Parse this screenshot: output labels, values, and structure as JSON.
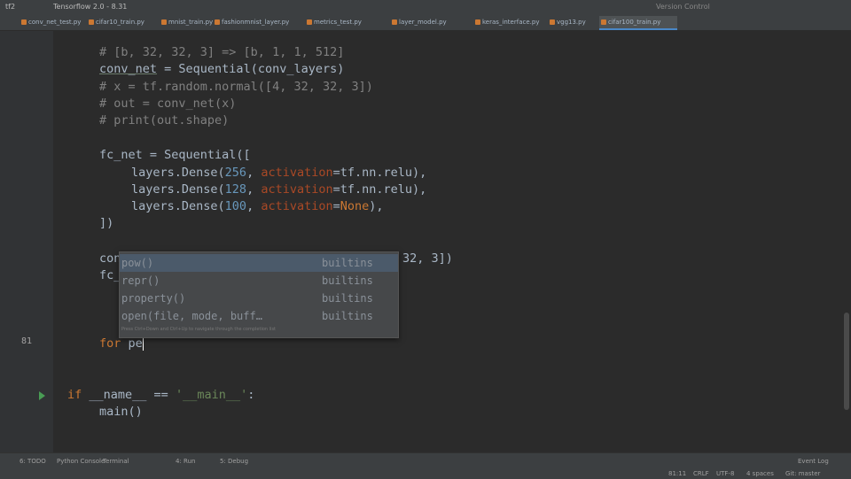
{
  "window": {
    "title": "Tensorflow 2.0 - 8.31",
    "project_label": "tf2",
    "menu_hint": "Version Control"
  },
  "tabs": [
    {
      "label": "conv_net_test.py",
      "color": "#cc7832"
    },
    {
      "label": "cifar10_train.py",
      "color": "#cc7832"
    },
    {
      "label": "mnist_train.py",
      "color": "#cc7832"
    },
    {
      "label": "fashionmnist_layer.py",
      "color": "#cc7832"
    },
    {
      "label": "metrics_test.py",
      "color": "#cc7832"
    },
    {
      "label": "layer_model.py",
      "color": "#cc7832"
    },
    {
      "label": "keras_interface.py",
      "color": "#cc7832"
    },
    {
      "label": "vgg13.py",
      "color": "#cc7832"
    },
    {
      "label": "cifar100_train.py",
      "color": "#cc7832",
      "active": true
    }
  ],
  "code": {
    "lines": [
      {
        "num": "",
        "comment": "# [b, 32, 32, 3] => [b, 1, 1, 512]"
      },
      {
        "num": "",
        "var": "conv_net",
        "eq": " = Sequential(conv_layers)"
      },
      {
        "num": "",
        "comment": "# x = tf.random.normal([4, 32, 32, 3])"
      },
      {
        "num": "",
        "comment": "# out = conv_net(x)"
      },
      {
        "num": "",
        "comment": "# print(out.shape)"
      },
      {
        "num": "",
        "text": "fc_net = Sequential(["
      },
      {
        "num": "",
        "a": "layers.Dense(",
        "n": "256",
        "b": ", ",
        "p": "activation",
        "c": "=tf.nn.relu),"
      },
      {
        "num": "",
        "a": "layers.Dense(",
        "n": "128",
        "b": ", ",
        "p": "activation",
        "c": "=tf.nn.relu),"
      },
      {
        "num": "",
        "a": "layers.Dense(",
        "n": "100",
        "b": ", ",
        "p": "activation",
        "c": "=",
        "k": "None",
        "d": "),"
      },
      {
        "num": "",
        "text": "])"
      },
      {
        "num": "",
        "text": "con",
        "tail": "32, 3])"
      },
      {
        "num": "",
        "text": "fc_"
      },
      {
        "num": "81",
        "kwtext": "for",
        "rest": " pe"
      },
      {
        "num": "",
        "kwtext": "if",
        "main_a": " __name__ == ",
        "main_s": "'__main__'",
        "main_b": ":"
      },
      {
        "num": "",
        "text": "main()"
      }
    ],
    "current_line": "81"
  },
  "autocomplete": {
    "items": [
      {
        "name": "pow()",
        "type": "builtins"
      },
      {
        "name": "repr()",
        "type": "builtins"
      },
      {
        "name": "property()",
        "type": "builtins"
      },
      {
        "name": "open(file, mode, buff…",
        "type": "builtins"
      }
    ],
    "hint": "Press Ctrl+Down and Ctrl+Up to navigate through the completion list"
  },
  "statusbar": {
    "items": [
      "6: TODO",
      "Python Console",
      "Terminal",
      "4: Run",
      "5: Debug"
    ],
    "right": [
      "81:11",
      "CRLF",
      "UTF-8",
      "4 spaces",
      "Git: master"
    ],
    "event_log": "Event Log"
  }
}
